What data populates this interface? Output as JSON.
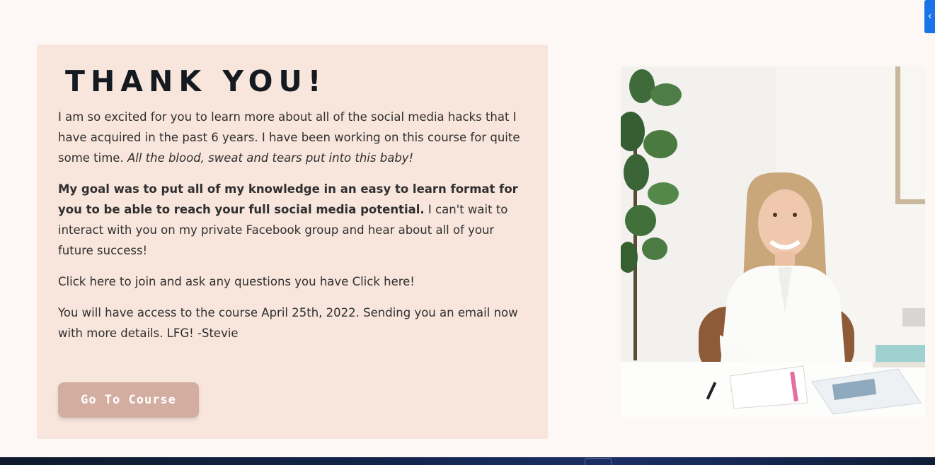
{
  "side_tab": {
    "icon": "chevron-left-icon",
    "glyph": "‹"
  },
  "card": {
    "title": "THANK YOU!",
    "paragraph1": {
      "text": "I am so excited for you to learn more about all of the social media hacks that I have acquired in the past 6 years. I have been working on this course for quite some time. ",
      "italic": "All the blood, sweat and tears put into this baby!"
    },
    "paragraph2": {
      "bold": "My goal was to put all of my knowledge in an easy to learn format for you to be able to reach your full social media potential.",
      "text": " I can't wait to interact with you on my private Facebook group and hear about all of your future success!"
    },
    "paragraph3": {
      "text": "Click here to join and ask any questions you have  ",
      "link": "Click here!"
    },
    "paragraph4": {
      "text": "You will have access to the course April 25th, 2022. Sending you an email now with more details. LFG! -Stevie"
    },
    "button_label": "Go To Course"
  },
  "photo": {
    "alt": ""
  },
  "colors": {
    "page_bg": "#fdf7f5",
    "card_bg": "#f8e6dc",
    "button_bg": "#d2ada0",
    "title": "#141a1f",
    "body_text": "#2f2f2f",
    "side_tab": "#1a73e8"
  }
}
